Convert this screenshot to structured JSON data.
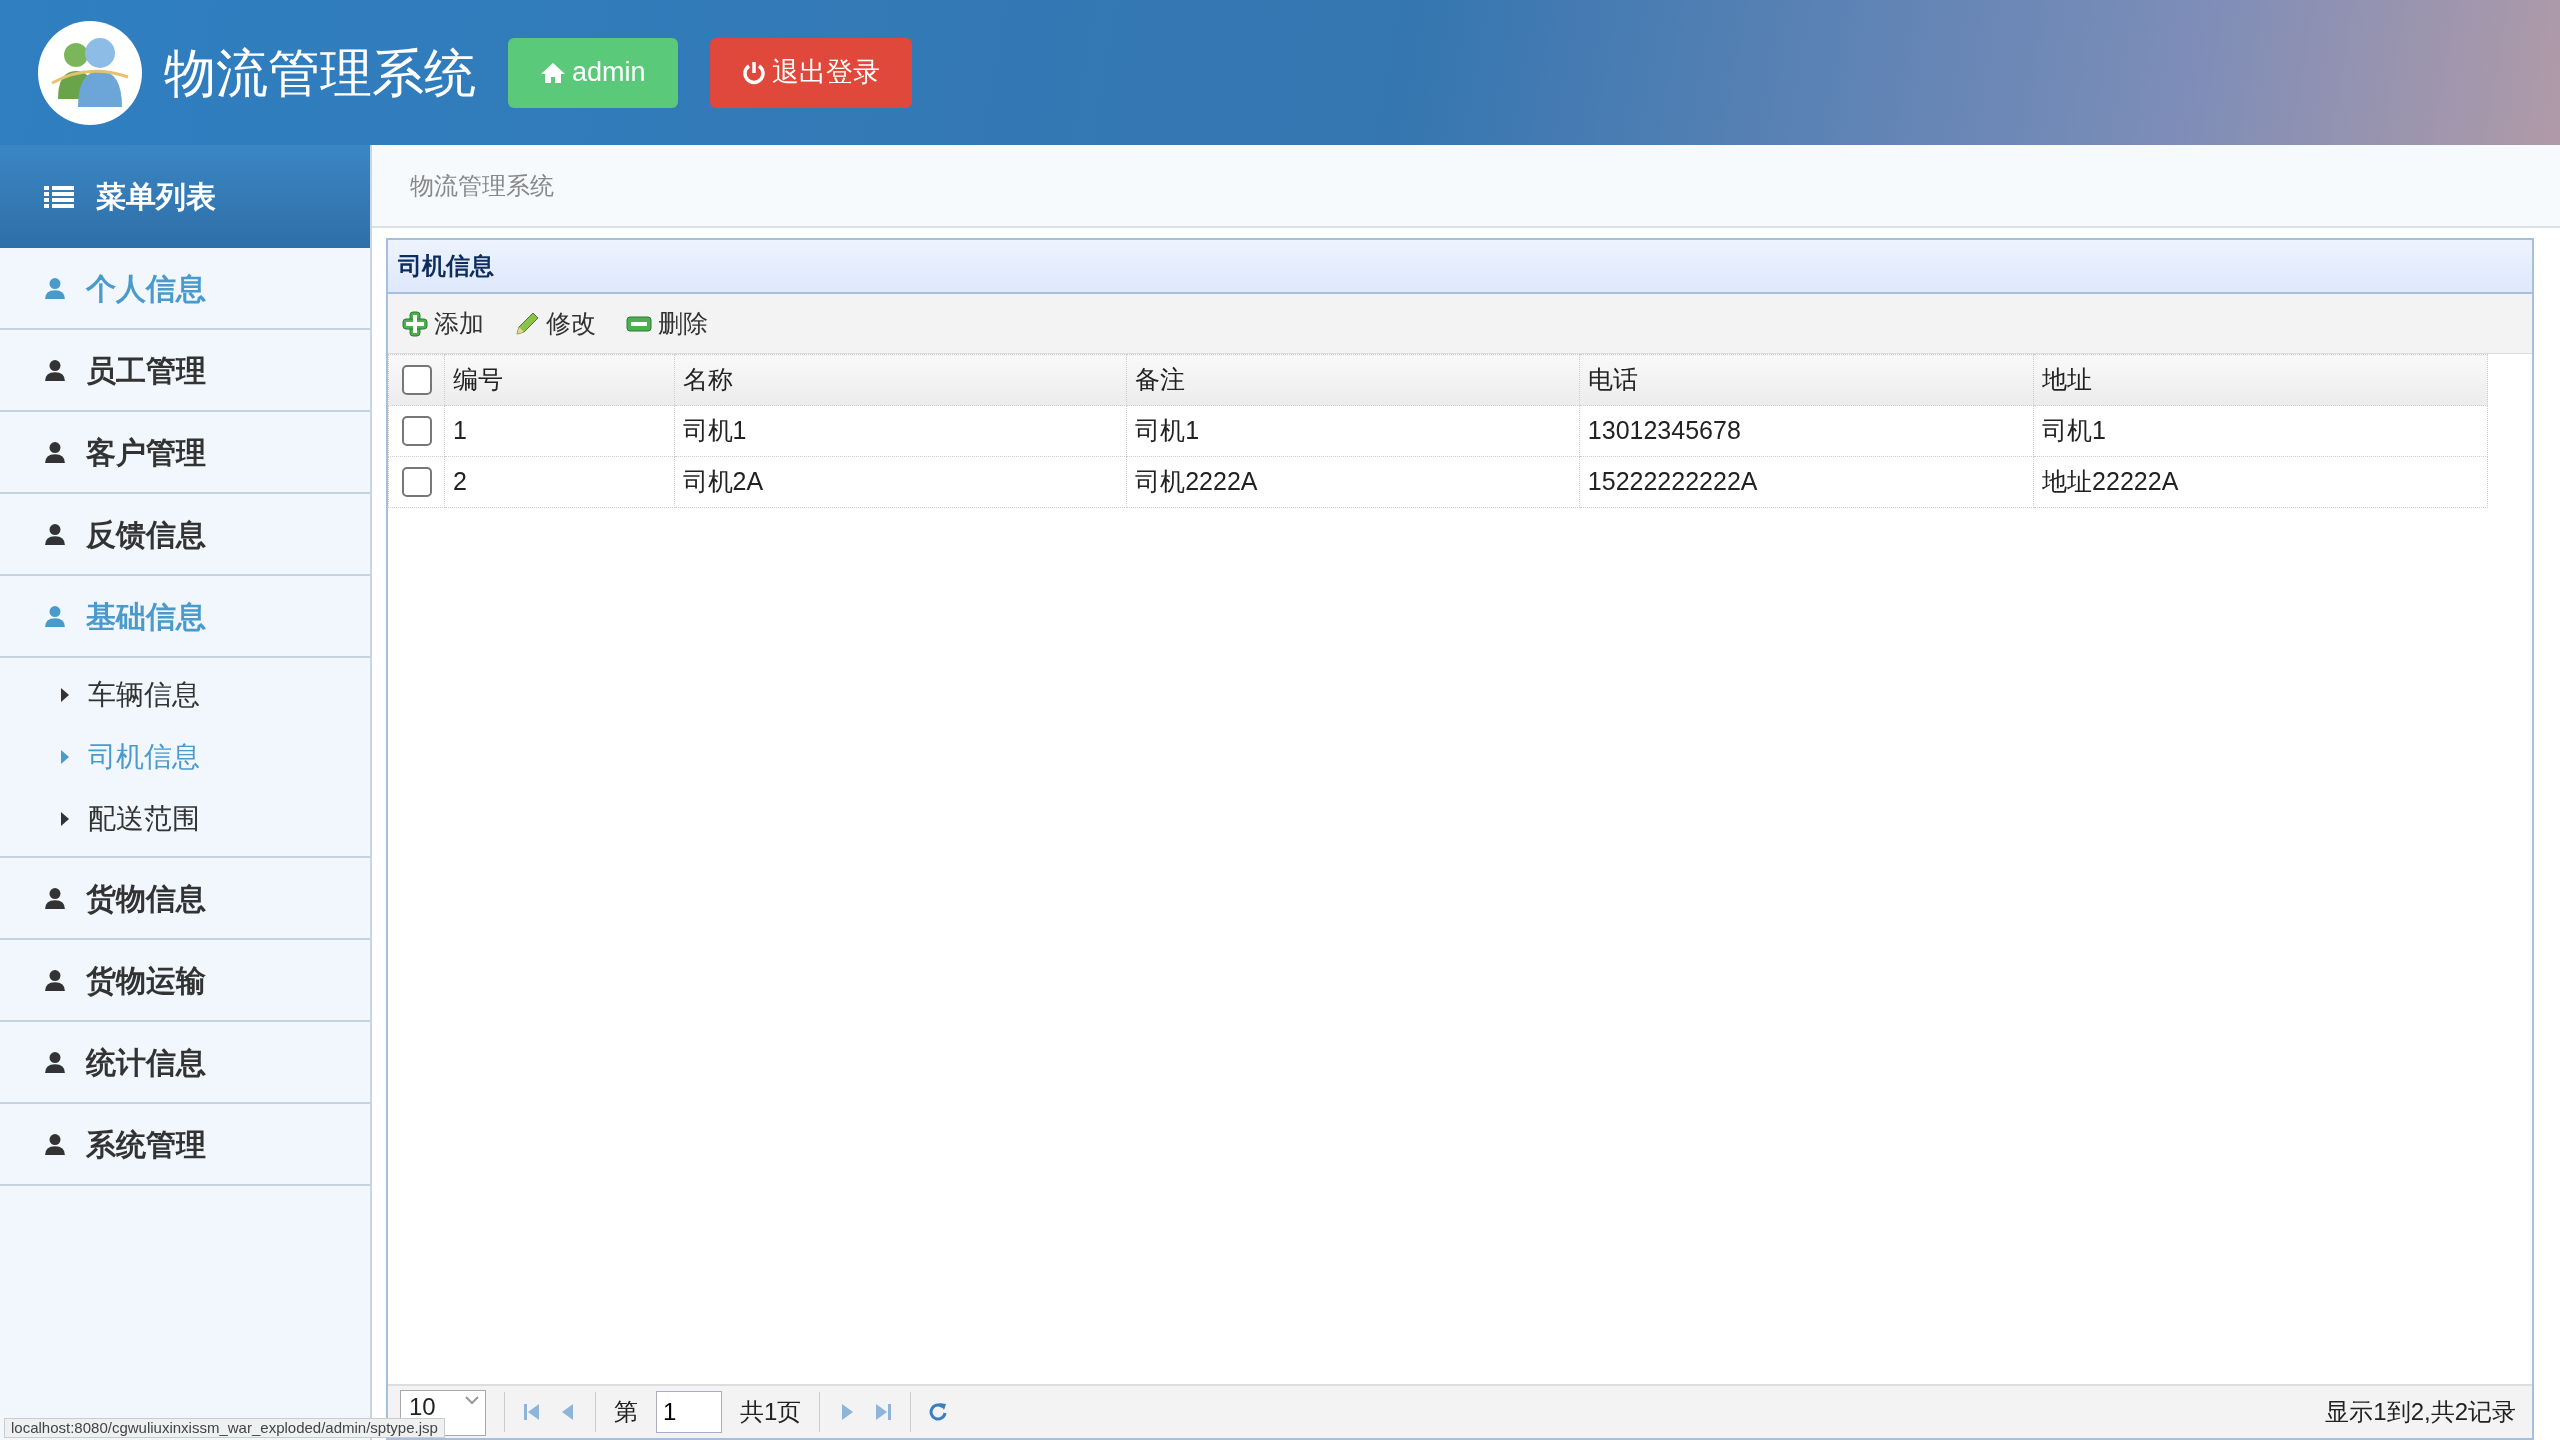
{
  "header": {
    "title": "物流管理系统",
    "user_button": "admin",
    "logout_button": "退出登录"
  },
  "sidebar": {
    "title": "菜单列表",
    "items": [
      {
        "label": "个人信息",
        "selected": true
      },
      {
        "label": "员工管理",
        "selected": false
      },
      {
        "label": "客户管理",
        "selected": false
      },
      {
        "label": "反馈信息",
        "selected": false
      },
      {
        "label": "基础信息",
        "selected": true,
        "children": [
          {
            "label": "车辆信息",
            "selected": false
          },
          {
            "label": "司机信息",
            "selected": true
          },
          {
            "label": "配送范围",
            "selected": false
          }
        ]
      },
      {
        "label": "货物信息",
        "selected": false
      },
      {
        "label": "货物运输",
        "selected": false
      },
      {
        "label": "统计信息",
        "selected": false
      },
      {
        "label": "系统管理",
        "selected": false
      }
    ]
  },
  "breadcrumb": "物流管理系统",
  "panel": {
    "title": "司机信息",
    "toolbar": [
      {
        "label": "添加",
        "kind": "add"
      },
      {
        "label": "修改",
        "kind": "edit"
      },
      {
        "label": "删除",
        "kind": "delete"
      }
    ],
    "table": {
      "header_checked": false,
      "columns": [
        "编号",
        "名称",
        "备注",
        "电话",
        "地址"
      ],
      "rows": [
        {
          "checked": false,
          "cells": [
            "1",
            "司机1",
            "司机1",
            "13012345678",
            "司机1"
          ]
        },
        {
          "checked": false,
          "cells": [
            "2",
            "司机2A",
            "司机2222A",
            "15222222222A",
            "地址22222A"
          ]
        }
      ]
    },
    "pager": {
      "page_size": "10",
      "page_prefix": "第",
      "page": "1",
      "page_suffix": "共1页",
      "summary": "显示1到2,共2记录"
    }
  },
  "status_bar": "localhost:8080/cgwuliuxinxissm_war_exploded/admin/sptype.jsp"
}
